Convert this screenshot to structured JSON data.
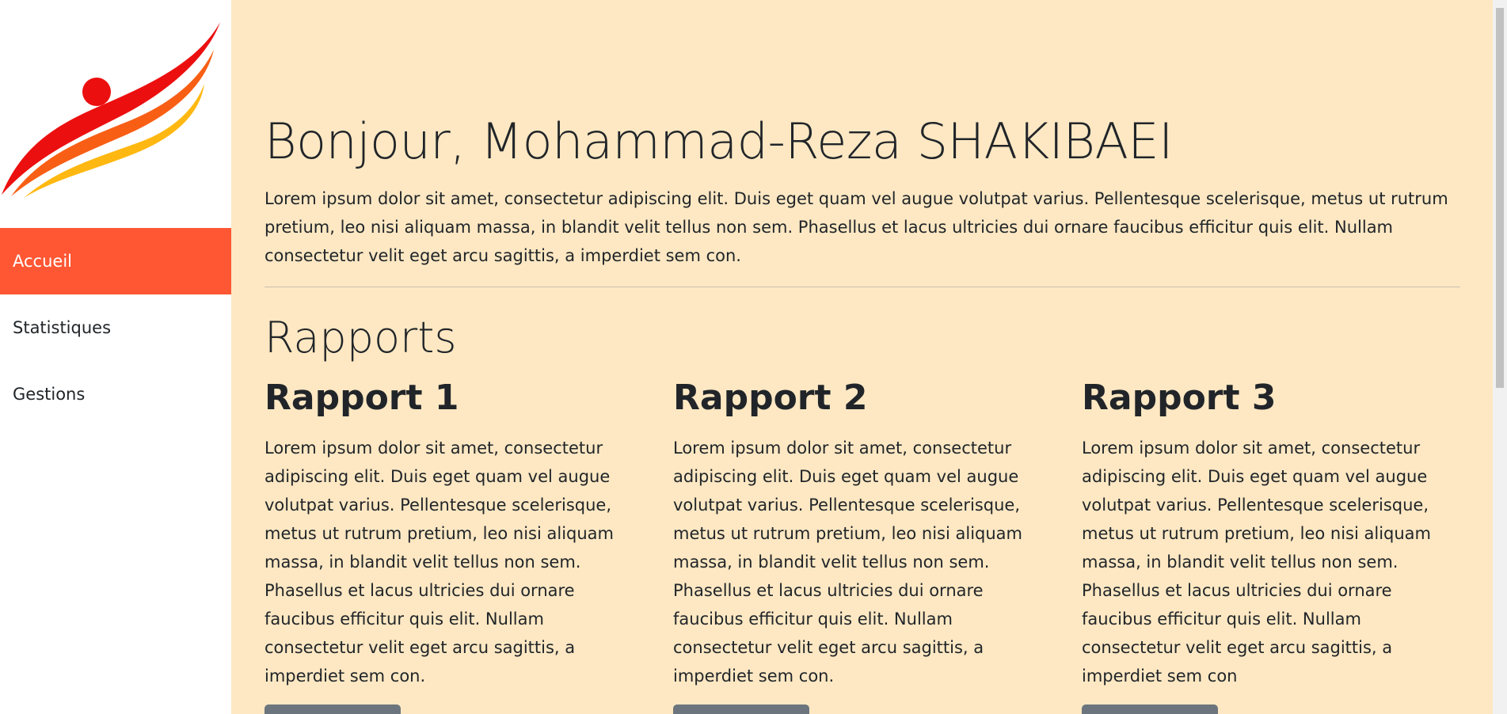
{
  "sidebar": {
    "logo_icon": "flame-runner-logo",
    "items": [
      {
        "label": "Accueil",
        "active": true
      },
      {
        "label": "Statistiques",
        "active": false
      },
      {
        "label": "Gestions",
        "active": false
      }
    ]
  },
  "main": {
    "greeting": "Bonjour, Mohammad-Reza SHAKIBAEI",
    "intro": "Lorem ipsum dolor sit amet, consectetur adipiscing elit. Duis eget quam vel augue volutpat varius. Pellentesque scelerisque, metus ut rutrum pretium, leo nisi aliquam massa, in blandit velit tellus non sem. Phasellus et lacus ultricies dui ornare faucibus efficitur quis elit. Nullam consectetur velit eget arcu sagittis, a imperdiet sem con.",
    "section_title": "Rapports",
    "reports": [
      {
        "title": "Rapport 1",
        "text": "Lorem ipsum dolor sit amet, consectetur adipiscing elit. Duis eget quam vel augue volutpat varius. Pellentesque scelerisque, metus ut rutrum pretium, leo nisi aliquam massa, in blandit velit tellus non sem. Phasellus et lacus ultricies dui ornare faucibus efficitur quis elit. Nullam consectetur velit eget arcu sagittis, a imperdiet sem con."
      },
      {
        "title": "Rapport 2",
        "text": "Lorem ipsum dolor sit amet, consectetur adipiscing elit. Duis eget quam vel augue volutpat varius. Pellentesque scelerisque, metus ut rutrum pretium, leo nisi aliquam massa, in blandit velit tellus non sem. Phasellus et lacus ultricies dui ornare faucibus efficitur quis elit. Nullam consectetur velit eget arcu sagittis, a imperdiet sem con."
      },
      {
        "title": "Rapport 3",
        "text": "Lorem ipsum dolor sit amet, consectetur adipiscing elit. Duis eget quam vel augue volutpat varius. Pellentesque scelerisque, metus ut rutrum pretium, leo nisi aliquam massa, in blandit velit tellus non sem. Phasellus et lacus ultricies dui ornare faucibus efficitur quis elit. Nullam consectetur velit eget arcu sagittis, a imperdiet sem con"
      }
    ]
  },
  "colors": {
    "accent": "#ff5733",
    "background": "#fde8c3",
    "button": "#6c757d"
  }
}
